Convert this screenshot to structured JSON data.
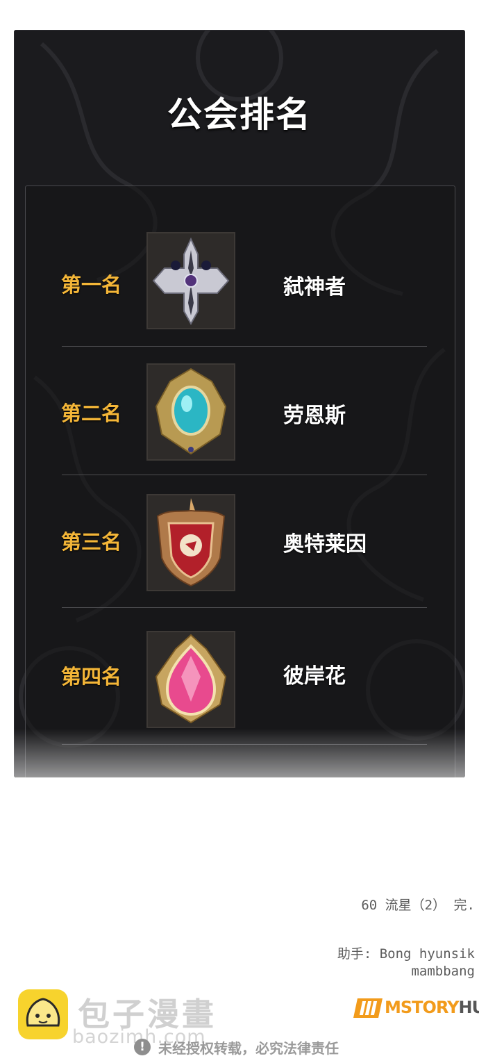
{
  "panel": {
    "title": "公会排名",
    "rankings": [
      {
        "rank": "第一名",
        "guild": "弑神者",
        "emblem": "silver-cross-emblem"
      },
      {
        "rank": "第二名",
        "guild": "劳恩斯",
        "emblem": "cyan-gem-emblem"
      },
      {
        "rank": "第三名",
        "guild": "奥特莱因",
        "emblem": "red-lion-shield-emblem"
      },
      {
        "rank": "第四名",
        "guild": "彼岸花",
        "emblem": "pink-gem-emblem"
      }
    ],
    "colors": {
      "rank": "#f4b638",
      "guild": "#ffffff",
      "background": "#1b1b1e"
    }
  },
  "footer": {
    "chapter_end": "60 流星（2） 完.",
    "assistant": "助手: Bong hyunsik",
    "assistant2": "mambbang",
    "publisher": "MSTORY",
    "publisher_suffix": "HUB",
    "watermark_cn": "包子漫畫",
    "watermark_url": "baozimh.com",
    "notice": "未经授权转载，必究法律责任"
  }
}
